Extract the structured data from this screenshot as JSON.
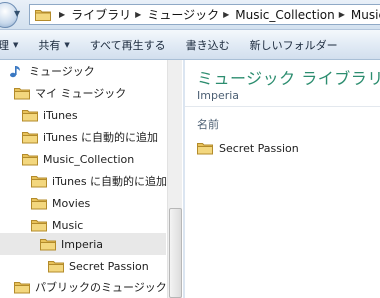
{
  "address": {
    "breadcrumbs": [
      "ライブラリ",
      "ミュージック",
      "Music_Collection",
      "Music"
    ]
  },
  "toolbar": {
    "organize_label": "理",
    "share_label": "共有",
    "play_all_label": "すべて再生する",
    "burn_label": "書き込む",
    "new_folder_label": "新しいフォルダー"
  },
  "nav": {
    "items": [
      {
        "label": "ミュージック",
        "icon": "music-note-icon"
      },
      {
        "label": "マイ ミュージック",
        "icon": "folder-icon"
      },
      {
        "label": "iTunes",
        "icon": "folder-icon"
      },
      {
        "label": "iTunes に自動的に追加",
        "icon": "folder-icon"
      },
      {
        "label": "Music_Collection",
        "icon": "folder-icon"
      },
      {
        "label": "iTunes に自動的に追加",
        "icon": "folder-icon"
      },
      {
        "label": "Movies",
        "icon": "folder-icon"
      },
      {
        "label": "Music",
        "icon": "folder-icon"
      },
      {
        "label": "Imperia",
        "icon": "folder-icon",
        "selected": true
      },
      {
        "label": "Secret Passion",
        "icon": "folder-icon"
      },
      {
        "label": "パブリックのミュージック",
        "icon": "folder-icon"
      }
    ]
  },
  "content": {
    "library_title": "ミュージック ライブラリ",
    "library_subtitle": "Imperia",
    "column_header": "名前",
    "files": [
      {
        "name": "Secret Passion",
        "icon": "folder-icon"
      }
    ]
  },
  "colors": {
    "accent_title": "#2c8d6f",
    "folder": "#e8c25a",
    "selection": "#e8e8e8"
  }
}
